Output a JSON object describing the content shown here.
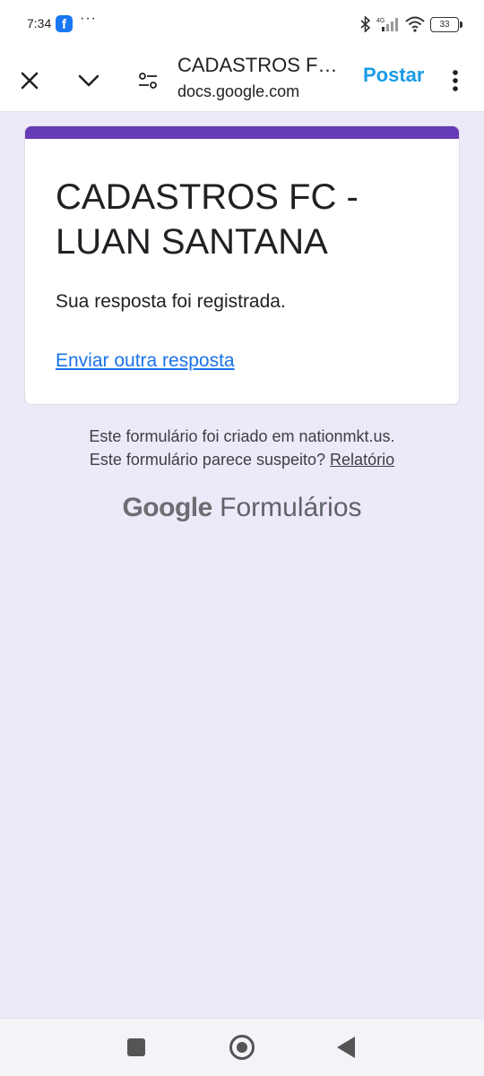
{
  "status_bar": {
    "time": "7:34",
    "app_icon": "facebook-icon",
    "more": "···",
    "network": "4G",
    "battery": "33"
  },
  "tab_bar": {
    "title": "CADASTROS FC - LUAN SANTANA",
    "url": "docs.google.com",
    "post_label": "Postar",
    "icons": [
      "close-icon",
      "chevron-down-icon",
      "tune-icon",
      "more-vert-icon"
    ]
  },
  "form": {
    "title": "CADASTROS FC - LUAN SANTANA",
    "confirmation": "Sua resposta foi registrada.",
    "another_link": "Enviar outra resposta",
    "accent_color": "#673ab7"
  },
  "footer": {
    "created_in": "Este formulário foi criado em nationmkt.us.",
    "suspicious": "Este formulário parece suspeito?",
    "report_link": "Relatório",
    "brand_google": "Google",
    "brand_product": "Formulários"
  },
  "nav": {
    "icons": [
      "recents-square-icon",
      "home-circle-icon",
      "back-triangle-icon"
    ]
  }
}
